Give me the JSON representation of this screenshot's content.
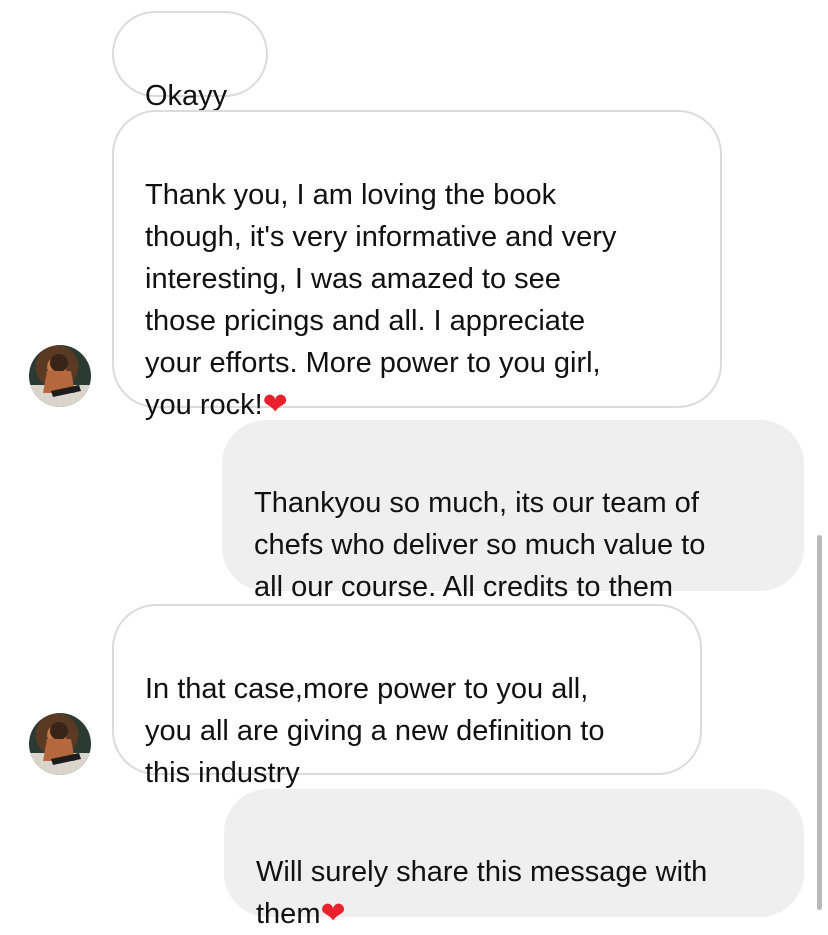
{
  "messages": [
    {
      "side": "incoming",
      "text": "Okayy",
      "heart": false
    },
    {
      "side": "incoming",
      "text": "Thank you, I am loving the book\nthough, it's very informative and very\ninteresting, I was amazed to see\nthose pricings and all. I appreciate\nyour efforts. More power to you girl,\nyou rock!",
      "heart": true
    },
    {
      "side": "outgoing",
      "text": "Thankyou so much, its our team of\nchefs who deliver so much value to\nall our course. All credits to them",
      "heart": false
    },
    {
      "side": "incoming",
      "text": "In that case,more power to you all,\nyou all are giving a new definition to\nthis industry",
      "heart": false
    },
    {
      "side": "outgoing",
      "text": "Will surely share this message with\nthem",
      "heart": true
    }
  ],
  "emoji": {
    "heart": "❤"
  },
  "colors": {
    "incoming_bg": "#ffffff",
    "incoming_border": "#dbdbdb",
    "outgoing_bg": "#efefef",
    "heart": "#e8212c"
  }
}
